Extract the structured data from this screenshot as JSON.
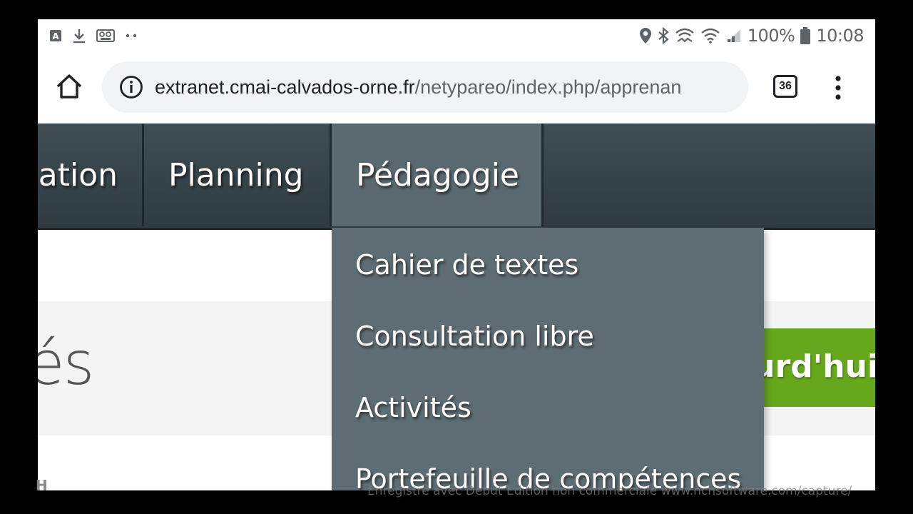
{
  "status_bar": {
    "left_icons": [
      "font-notification-icon",
      "download-icon",
      "voicemail-icon",
      "more-dots-icon"
    ],
    "right_icons": [
      "location-icon",
      "bluetooth-icon",
      "wifi-calling-icon",
      "wifi-icon",
      "cell-signal-icon",
      "battery-icon"
    ],
    "battery": "100%",
    "time": "10:08"
  },
  "browser": {
    "url_host": "extranet.cmai-calvados-orne.fr",
    "url_path": "/netypareo/index.php/apprenan",
    "tab_count": "36"
  },
  "nav": {
    "items": [
      {
        "label": "ation"
      },
      {
        "label": "Planning"
      },
      {
        "label": "Pédagogie"
      }
    ]
  },
  "dropdown": {
    "items": [
      {
        "label": "Cahier de textes"
      },
      {
        "label": "Consultation libre"
      },
      {
        "label": "Activités"
      },
      {
        "label": "Portefeuille de compétences"
      }
    ]
  },
  "content": {
    "heading_fragment": "és",
    "green_button_label": "ourd'hui"
  },
  "watermark": {
    "text": "Enregistré avec Debut Édition non commerciale www.nchsoftware.com/capture/"
  },
  "colors": {
    "nav_bg": "#34424a",
    "nav_active": "#5a686f",
    "dropdown_bg": "#5e6c73",
    "green_accent": "#66a81c"
  }
}
